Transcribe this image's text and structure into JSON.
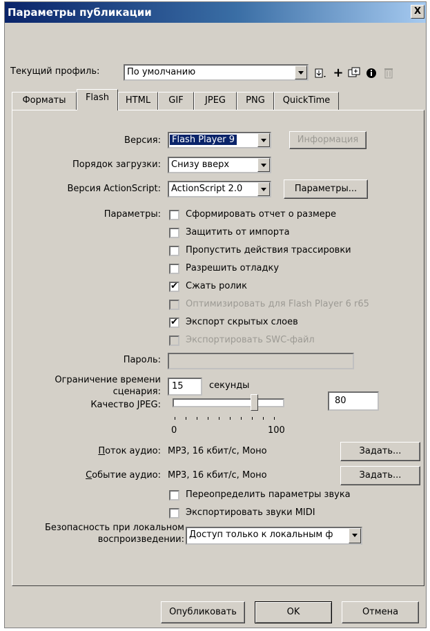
{
  "dialog": {
    "title": "Параметры публикации",
    "close_glyph": "X"
  },
  "profile": {
    "label": "Текущий профиль:",
    "value": "По умолчанию"
  },
  "toolbar": [
    "import-export-icon",
    "add-profile-icon",
    "duplicate-profile-icon",
    "profile-info-icon",
    "delete-profile-icon"
  ],
  "tabs": [
    "Форматы",
    "Flash",
    "HTML",
    "GIF",
    "JPEG",
    "PNG",
    "QuickTime"
  ],
  "active_tab": "Flash",
  "version": {
    "label": "Версия:",
    "value": "Flash Player 9",
    "info_button": "Информация"
  },
  "load_order": {
    "label": "Порядок загрузки:",
    "value": "Снизу вверх"
  },
  "actionscript": {
    "label": "Версия ActionScript:",
    "value": "ActionScript 2.0",
    "settings_button": "Параметры..."
  },
  "options": {
    "label": "Параметры:",
    "items": [
      {
        "label": "Сформировать отчет о размере",
        "checked": false,
        "enabled": true
      },
      {
        "label": "Защитить от импорта",
        "checked": false,
        "enabled": true
      },
      {
        "label": "Пропустить действия трассировки",
        "checked": false,
        "enabled": true
      },
      {
        "label": "Разрешить отладку",
        "checked": false,
        "enabled": true
      },
      {
        "label": "Сжать ролик",
        "checked": true,
        "enabled": true
      },
      {
        "label": "Оптимизировать для Flash Player 6 r65",
        "checked": false,
        "enabled": false
      },
      {
        "label": "Экспорт скрытых слоев",
        "checked": true,
        "enabled": true
      },
      {
        "label": "Экспортировать SWC-файл",
        "checked": false,
        "enabled": false
      }
    ]
  },
  "password": {
    "label": "Пароль:",
    "value": ""
  },
  "script_limit": {
    "label_line1": "Ограничение времени",
    "label_line2": "сценария:",
    "value": "15",
    "unit": "секунды"
  },
  "jpeg_quality": {
    "label": "Качество JPEG:",
    "value": "80",
    "min_label": "0",
    "max_label": "100",
    "level": 0.8
  },
  "audio_stream": {
    "label": "Поток аудио:",
    "value": "MP3, 16 кбит/с, Моно",
    "button": "Задать..."
  },
  "audio_event": {
    "label": "Событие аудио:",
    "value": "MP3, 16 кбит/с, Моно",
    "button": "Задать..."
  },
  "sound_options": [
    {
      "label": "Переопределить параметры звука",
      "checked": false
    },
    {
      "label": "Экспортировать звуки MIDI",
      "checked": false
    }
  ],
  "local_security": {
    "label_line1": "Безопасность при локальном",
    "label_line2": "воспроизведении:",
    "value": "Доступ только к локальным ф"
  },
  "footer": {
    "publish": "Опубликовать",
    "ok": "OK",
    "cancel": "Отмена"
  }
}
